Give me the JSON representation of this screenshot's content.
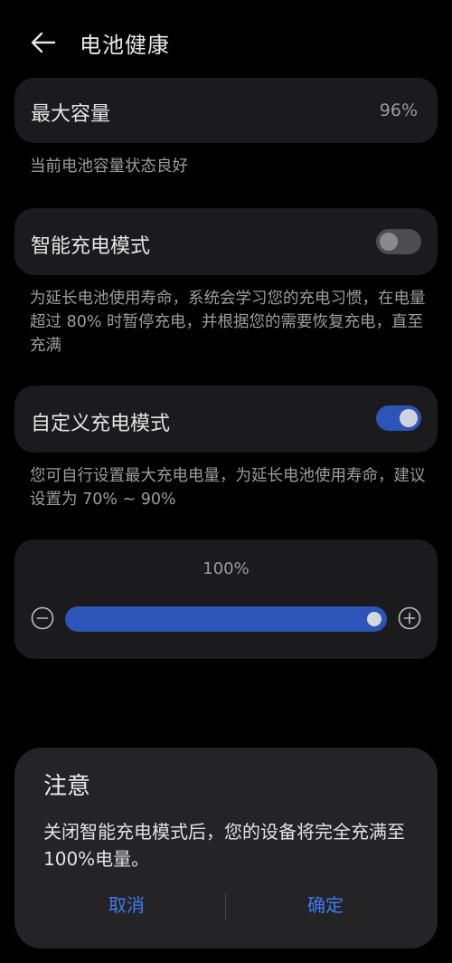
{
  "header": {
    "title": "电池健康",
    "back_icon": "arrow-left-icon"
  },
  "max_capacity": {
    "label": "最大容量",
    "value": "96%",
    "description": "当前电池容量状态良好"
  },
  "smart_charging": {
    "label": "智能充电模式",
    "enabled": false,
    "description": "为延长电池使用寿命，系统会学习您的充电习惯，在电量超过 80% 时暂停充电，并根据您的需要恢复充电，直至充满"
  },
  "custom_charging": {
    "label": "自定义充电模式",
    "enabled": true,
    "description": "您可自行设置最大充电电量，为延长电池使用寿命，建议设置为 70% ~ 90%"
  },
  "charge_limit": {
    "percent_label": "100%",
    "value_fraction": 1.0,
    "decrease_icon": "minus-circle-icon",
    "increase_icon": "plus-circle-icon"
  },
  "dialog": {
    "title": "注意",
    "message": "关闭智能充电模式后，您的设备将完全充满至100%电量。",
    "cancel_label": "取消",
    "confirm_label": "确定"
  },
  "colors": {
    "accent": "#2d55b9",
    "dialog_button": "#3d7bf0",
    "background": "#000000",
    "card": "#1b1b1d"
  }
}
